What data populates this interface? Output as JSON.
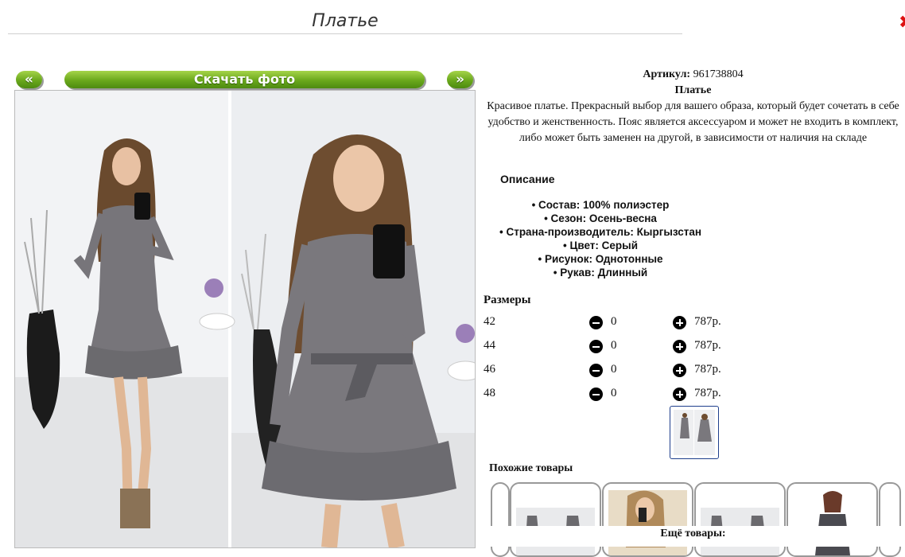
{
  "header": {
    "title": "Платье",
    "close_glyph": "✖"
  },
  "gallery": {
    "prev_label": "«",
    "download_label": "Скачать фото",
    "next_label": "»"
  },
  "product": {
    "article_label": "Артикул:",
    "article_value": "961738804",
    "name": "Платье",
    "description": "Красивое платье. Прекрасный выбор для вашего образа, который будет сочетать в себе удобство и женственность. Пояс является аксессуаром и может не входить в комплект, либо может быть заменен на другой, в зависимости от наличия на складе"
  },
  "specs": {
    "heading": "Описание",
    "items": [
      "Состав: 100% полиэстер",
      "Сезон: Осень-весна",
      "Страна-производитель: Кыргызстан",
      "Цвет: Серый",
      "Рисунок: Однотонные",
      "Рукав: Длинный"
    ]
  },
  "sizes": {
    "heading": "Размеры",
    "rows": [
      {
        "size": "42",
        "qty": "0",
        "price": "787р."
      },
      {
        "size": "44",
        "qty": "0",
        "price": "787р."
      },
      {
        "size": "46",
        "qty": "0",
        "price": "787р."
      },
      {
        "size": "48",
        "qty": "0",
        "price": "787р."
      }
    ]
  },
  "similar": {
    "heading": "Похожие товары"
  },
  "more": {
    "heading": "Ещё товары:"
  },
  "colors": {
    "accent_green": "#6aa81c",
    "dress_gray": "#77757a",
    "close_red": "#dd1111"
  }
}
